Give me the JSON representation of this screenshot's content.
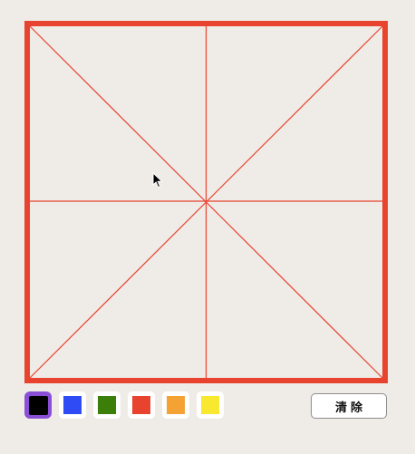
{
  "canvas": {
    "grid_type": "米字格",
    "border_color": "#e8432f",
    "guide_color": "#e8432f",
    "background": "#efebe7"
  },
  "palette": {
    "selected": "black",
    "colors": [
      {
        "name": "black",
        "hex": "#000000"
      },
      {
        "name": "blue",
        "hex": "#2e4bf5"
      },
      {
        "name": "green",
        "hex": "#3c7e0a"
      },
      {
        "name": "red",
        "hex": "#e8432f"
      },
      {
        "name": "orange",
        "hex": "#f4a233"
      },
      {
        "name": "yellow",
        "hex": "#f8e82f"
      }
    ]
  },
  "toolbar": {
    "clear_label": "清除"
  }
}
